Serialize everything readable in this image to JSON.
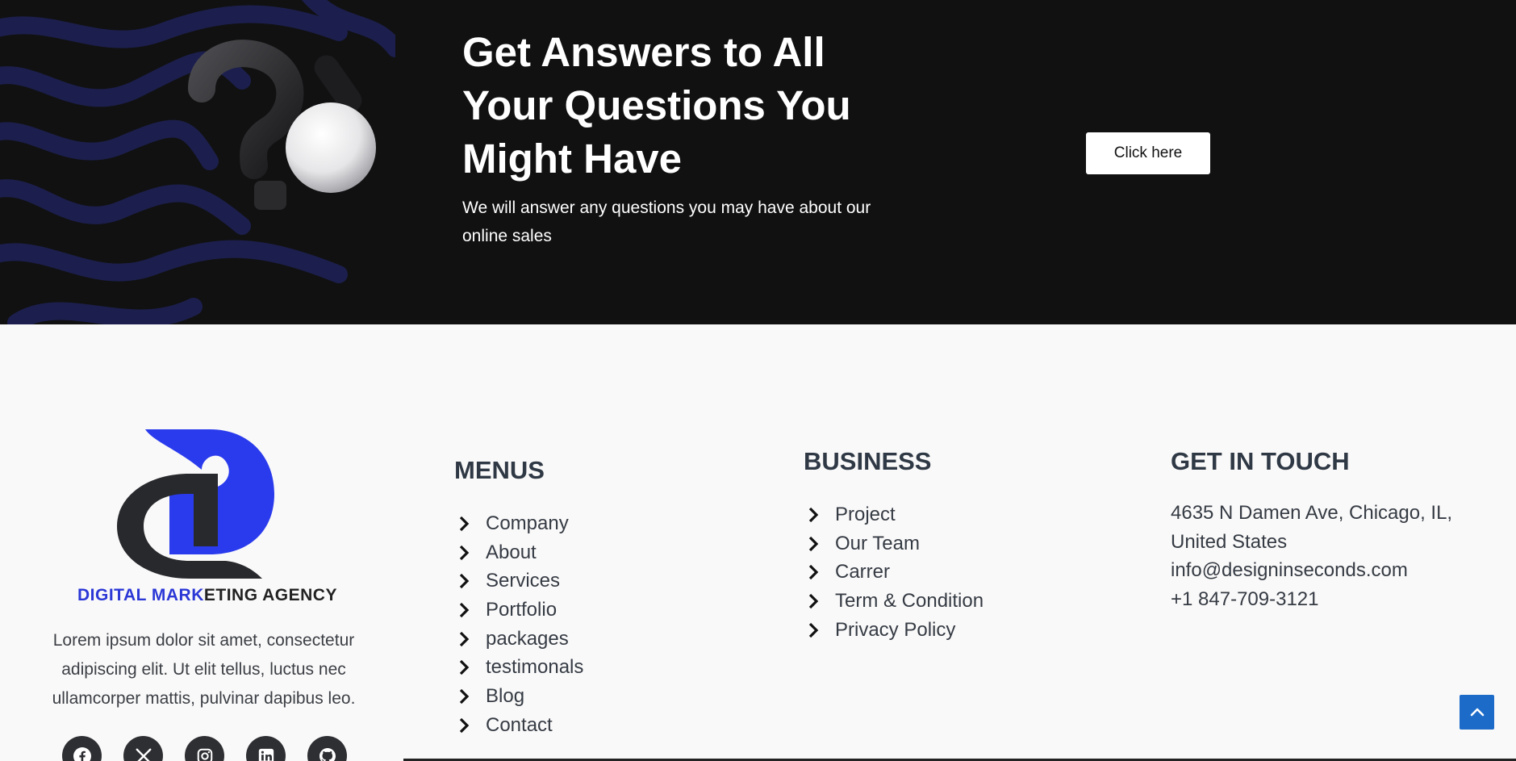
{
  "cta": {
    "title": "Get Answers to All Your Questions You Might Have",
    "subtitle": "We will answer any questions you may have about our online sales",
    "button_label": "Click here"
  },
  "footer": {
    "brand": {
      "name_part1": "DIGITAL MARK",
      "name_part2": "ETING AGENCY",
      "description": "Lorem ipsum dolor sit amet, consectetur adipiscing elit. Ut elit tellus, luctus nec ullamcorper mattis, pulvinar dapibus leo."
    },
    "socials": [
      {
        "icon": "facebook-icon"
      },
      {
        "icon": "x-twitter-icon"
      },
      {
        "icon": "instagram-icon"
      },
      {
        "icon": "linkedin-icon"
      },
      {
        "icon": "github-icon"
      }
    ],
    "menus": {
      "title": "MENUS",
      "items": [
        "Company",
        "About",
        "Services",
        "Portfolio",
        "packages",
        "testimonals",
        "Blog",
        "Contact"
      ]
    },
    "business": {
      "title": "BUSINESS",
      "items": [
        "Project",
        "Our Team",
        "Carrer",
        "Term & Condition",
        "Privacy Policy"
      ]
    },
    "contact": {
      "title": "GET IN TOUCH",
      "address": "4635 N Damen Ave, Chicago, IL, United States",
      "email": "info@designinseconds.com",
      "phone": "+1 847-709-3121"
    }
  },
  "colors": {
    "brand_blue": "#2b38d6",
    "cta_background": "#111112",
    "scroll_top_button": "#1c6bc9"
  },
  "scroll_top": {
    "icon": "chevron-up-icon"
  }
}
